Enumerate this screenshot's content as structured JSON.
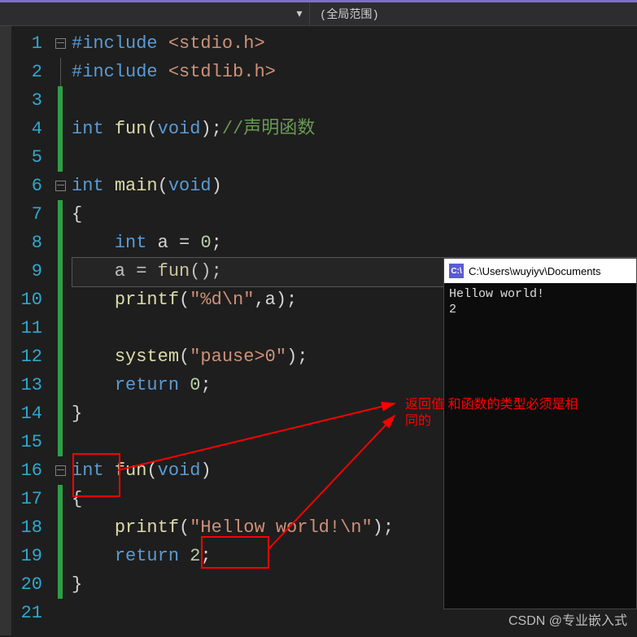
{
  "scope": {
    "dropdown_arrow": "▾",
    "label": "(全局范围)"
  },
  "line_numbers": [
    "1",
    "2",
    "3",
    "4",
    "5",
    "6",
    "7",
    "8",
    "9",
    "10",
    "11",
    "12",
    "13",
    "14",
    "15",
    "16",
    "17",
    "18",
    "19",
    "20",
    "21"
  ],
  "code": {
    "include1_kw": "#include ",
    "include1_hdr": "<stdio.h>",
    "include2_kw": "#include ",
    "include2_hdr": "<stdlib.h>",
    "l4_int": "int ",
    "l4_fun": "fun",
    "l4_p1": "(",
    "l4_void": "void",
    "l4_p2": ");",
    "l4_cm": "//声明函数",
    "l6_int": "int ",
    "l6_main": "main",
    "l6_p1": "(",
    "l6_void": "void",
    "l6_p2": ")",
    "l7": "{",
    "l8_int": "    int ",
    "l8_rest": "a = ",
    "l8_n": "0",
    "l8_semi": ";",
    "l9": "    a = ",
    "l9_fun": "fun",
    "l9_rest": "();",
    "l10_pre": "    ",
    "l10_fn": "printf",
    "l10_p": "(",
    "l10_s": "\"%d\\n\"",
    "l10_rest": ",a);",
    "l12_pre": "    ",
    "l12_fn": "system",
    "l12_p": "(",
    "l12_s": "\"pause>0\"",
    "l12_rest": ");",
    "l13_pre": "    ",
    "l13_ret": "return ",
    "l13_n": "0",
    "l13_semi": ";",
    "l14": "}",
    "l16_int": "int ",
    "l16_fun": "fun",
    "l16_p1": "(",
    "l16_void": "void",
    "l16_p2": ")",
    "l17": "{",
    "l18_pre": "    ",
    "l18_fn": "printf",
    "l18_p": "(",
    "l18_s": "\"Hellow world!\\n\"",
    "l18_rest": ");",
    "l19_pre": "    ",
    "l19_ret": "return ",
    "l19_n": "2",
    "l19_semi": ";",
    "l20": "}"
  },
  "console": {
    "icon": "C:\\",
    "title": "C:\\Users\\wuyiyv\\Documents",
    "out1": "Hellow world!",
    "out2": "2"
  },
  "annotation": {
    "line1": "返回值 和函数的类型必须是相",
    "line2": "同的"
  },
  "watermark": "CSDN @专业嵌入式"
}
